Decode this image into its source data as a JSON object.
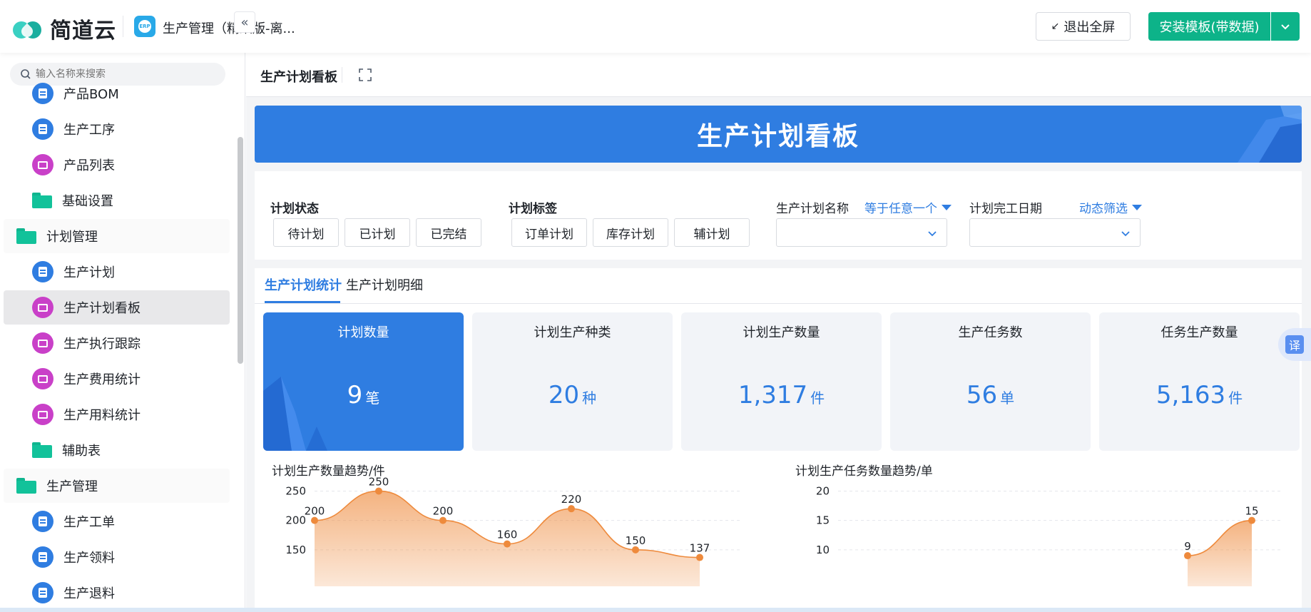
{
  "header": {
    "brand": "简道云",
    "app_name": "生产管理（精细版-离...",
    "exit_fullscreen": "退出全屏",
    "install_template": "安装模板(带数据)"
  },
  "sidebar": {
    "search_placeholder": "输入名称来搜索",
    "items": [
      {
        "label": "产品BOM",
        "type": "doc"
      },
      {
        "label": "生产工序",
        "type": "doc"
      },
      {
        "label": "产品列表",
        "type": "chart"
      },
      {
        "label": "基础设置",
        "type": "folder"
      },
      {
        "label": "计划管理",
        "type": "group"
      },
      {
        "label": "生产计划",
        "type": "doc"
      },
      {
        "label": "生产计划看板",
        "type": "chart",
        "active": true
      },
      {
        "label": "生产执行跟踪",
        "type": "chart"
      },
      {
        "label": "生产费用统计",
        "type": "chart"
      },
      {
        "label": "生产用料统计",
        "type": "chart"
      },
      {
        "label": "辅助表",
        "type": "folder"
      },
      {
        "label": "生产管理",
        "type": "group"
      },
      {
        "label": "生产工单",
        "type": "doc"
      },
      {
        "label": "生产领料",
        "type": "doc"
      },
      {
        "label": "生产退料",
        "type": "doc"
      }
    ]
  },
  "page": {
    "title": "生产计划看板",
    "banner_title": "生产计划看板"
  },
  "filters": {
    "plan_status": {
      "label": "计划状态",
      "options": [
        "待计划",
        "已计划",
        "已完结"
      ]
    },
    "plan_tag": {
      "label": "计划标签",
      "options": [
        "订单计划",
        "库存计划",
        "辅计划"
      ]
    },
    "plan_name": {
      "label": "生产计划名称",
      "operator": "等于任意一个"
    },
    "plan_date": {
      "label": "计划完工日期",
      "operator": "动态筛选"
    }
  },
  "tabs": [
    "生产计划统计",
    "生产计划明细"
  ],
  "stats": [
    {
      "title": "计划数量",
      "value": "9",
      "unit": "笔"
    },
    {
      "title": "计划生产种类",
      "value": "20",
      "unit": "种"
    },
    {
      "title": "计划生产数量",
      "value": "1,317",
      "unit": "件"
    },
    {
      "title": "生产任务数",
      "value": "56",
      "unit": "单"
    },
    {
      "title": "任务生产数量",
      "value": "5,163",
      "unit": "件"
    }
  ],
  "translate_label": "译",
  "colors": {
    "primary": "#2f7de1",
    "accent": "#0db389",
    "series": "#ee8a3c"
  },
  "chart_data": [
    {
      "type": "area",
      "title": "计划生产数量趋势/件",
      "y_ticks": [
        250,
        200,
        150
      ],
      "values": [
        200,
        250,
        200,
        160,
        220,
        150,
        137
      ],
      "ylim": [
        100,
        270
      ]
    },
    {
      "type": "area",
      "title": "计划生产任务数量趋势/单",
      "y_ticks": [
        20,
        15,
        10
      ],
      "values": [
        9,
        15
      ],
      "ylim": [
        5,
        22
      ]
    }
  ]
}
